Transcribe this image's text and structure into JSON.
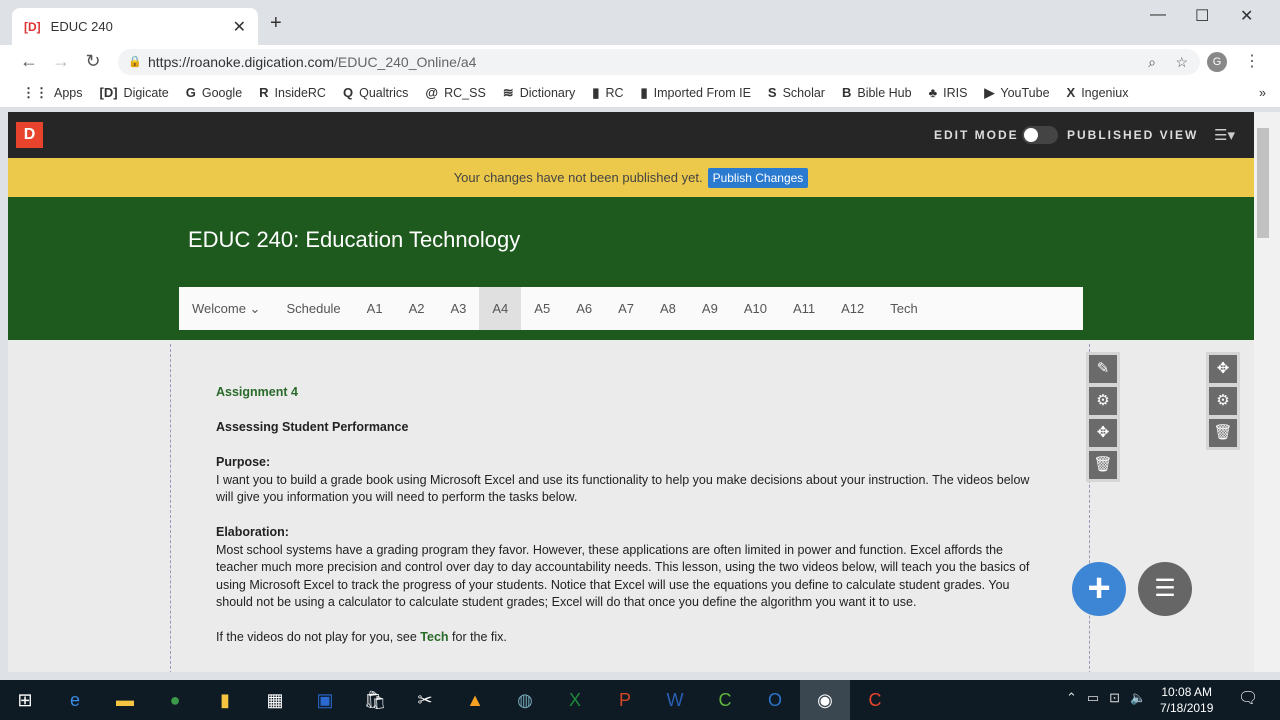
{
  "browser": {
    "tab_title": "EDUC 240",
    "tab_favicon": "[D]",
    "url_host": "https://roanoke.digication.com",
    "url_path": "/EDUC_240_Online/a4",
    "bookmarks": [
      {
        "icon": "apps-grid-icon",
        "label": "Apps",
        "glyph": "⋮⋮"
      },
      {
        "icon": "digicate-icon",
        "label": "Digicate",
        "glyph": "[D]"
      },
      {
        "icon": "google-icon",
        "label": "Google",
        "glyph": "G"
      },
      {
        "icon": "insiderc-icon",
        "label": "InsideRC",
        "glyph": "R"
      },
      {
        "icon": "qualtrics-icon",
        "label": "Qualtrics",
        "glyph": "Q"
      },
      {
        "icon": "rcss-icon",
        "label": "RC_SS",
        "glyph": "@"
      },
      {
        "icon": "dictionary-icon",
        "label": "Dictionary",
        "glyph": "≋"
      },
      {
        "icon": "folder-icon",
        "label": "RC",
        "glyph": "▮"
      },
      {
        "icon": "folder-icon",
        "label": "Imported From IE",
        "glyph": "▮"
      },
      {
        "icon": "scholar-icon",
        "label": "Scholar",
        "glyph": "S"
      },
      {
        "icon": "biblehub-icon",
        "label": "Bible Hub",
        "glyph": "B"
      },
      {
        "icon": "iris-icon",
        "label": "IRIS",
        "glyph": "♣"
      },
      {
        "icon": "youtube-icon",
        "label": "YouTube",
        "glyph": "▶"
      },
      {
        "icon": "ingeniux-icon",
        "label": "Ingeniux",
        "glyph": "X"
      }
    ],
    "more": "»",
    "profile_initial": "G"
  },
  "header": {
    "logo": "D",
    "edit_mode": "EDIT MODE",
    "published_view": "PUBLISHED VIEW",
    "edit_mode_on": false
  },
  "notice": {
    "text": "Your changes have not been published yet.",
    "button": "Publish Changes"
  },
  "site": {
    "title": "EDUC 240: Education Technology",
    "nav": [
      {
        "label": "Welcome ⌄"
      },
      {
        "label": "Schedule"
      },
      {
        "label": "A1"
      },
      {
        "label": "A2"
      },
      {
        "label": "A3"
      },
      {
        "label": "A4",
        "active": true
      },
      {
        "label": "A5"
      },
      {
        "label": "A6"
      },
      {
        "label": "A7"
      },
      {
        "label": "A8"
      },
      {
        "label": "A9"
      },
      {
        "label": "A10"
      },
      {
        "label": "A11"
      },
      {
        "label": "A12"
      },
      {
        "label": "Tech"
      }
    ]
  },
  "content": {
    "heading": "Assignment 4",
    "subheading": "Assessing Student Performance",
    "purpose_label": "Purpose:",
    "purpose_text": "I want you to build a grade book using Microsoft Excel and use its functionality to help you make decisions about your instruction. The videos below will give you information you will need to perform the tasks below.",
    "elab_label": "Elaboration:",
    "elab_text": "Most school systems have a grading program they favor. However, these applications are often limited in power and function. Excel affords the teacher much more precision and control over day to day accountability needs. This lesson, using the two videos below, will teach you the basics of using Microsoft Excel to track the progress of your students. Notice that Excel will use the equations you define to calculate student grades. You should not be using a calculator to calculate student grades; Excel will do that once you define the algorithm you want it to use.",
    "fix_pre": "If the videos do not play for you, see ",
    "fix_link": "Tech",
    "fix_post": " for the fix."
  },
  "taskbar": {
    "time": "10:08 AM",
    "date": "7/18/2019"
  },
  "colors": {
    "header": "#262626",
    "notice": "#ecc94b",
    "banner": "#1e5a1e",
    "accent": "#3d86d6"
  }
}
